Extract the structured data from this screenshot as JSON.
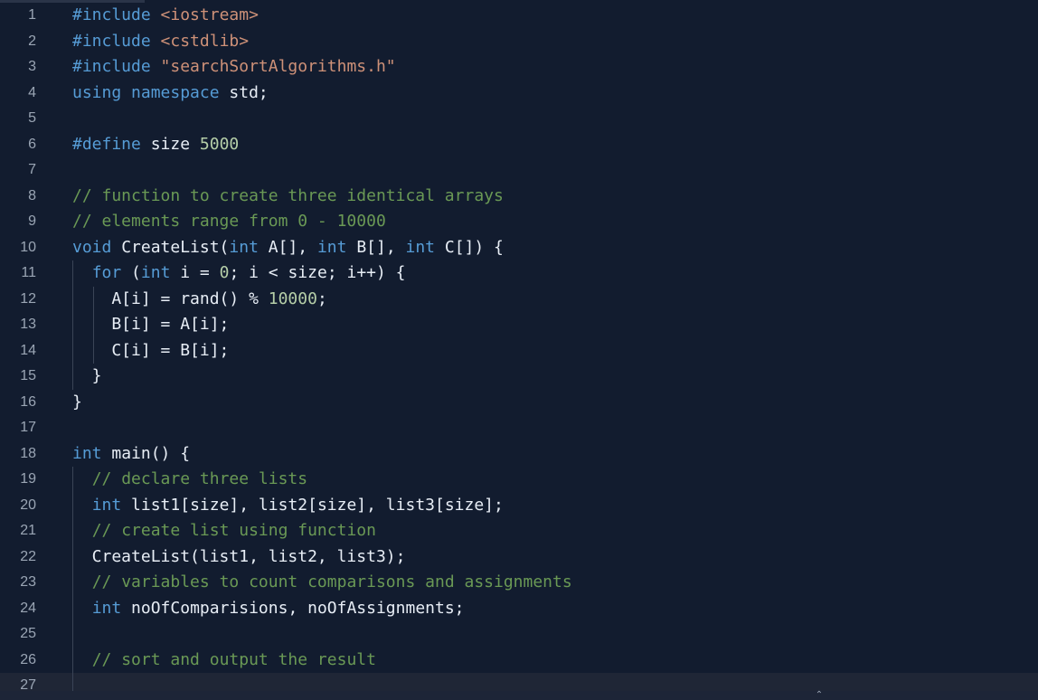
{
  "editor": {
    "lines": [
      {
        "n": "1",
        "tokens": [
          [
            "kw",
            "#include "
          ],
          [
            "str",
            "<iostream>"
          ]
        ]
      },
      {
        "n": "2",
        "tokens": [
          [
            "kw",
            "#include "
          ],
          [
            "str",
            "<cstdlib>"
          ]
        ]
      },
      {
        "n": "3",
        "tokens": [
          [
            "kw",
            "#include "
          ],
          [
            "str",
            "\"searchSortAlgorithms.h\""
          ]
        ]
      },
      {
        "n": "4",
        "tokens": [
          [
            "kw",
            "using "
          ],
          [
            "kw",
            "namespace "
          ],
          [
            "txt",
            "std;"
          ]
        ]
      },
      {
        "n": "5",
        "tokens": []
      },
      {
        "n": "6",
        "tokens": [
          [
            "kw",
            "#define "
          ],
          [
            "txt",
            "size "
          ],
          [
            "num",
            "5000"
          ]
        ]
      },
      {
        "n": "7",
        "tokens": []
      },
      {
        "n": "8",
        "tokens": [
          [
            "com",
            "// function to create three identical arrays"
          ]
        ]
      },
      {
        "n": "9",
        "tokens": [
          [
            "com",
            "// elements range from 0 - 10000"
          ]
        ]
      },
      {
        "n": "10",
        "tokens": [
          [
            "kw",
            "void "
          ],
          [
            "txt",
            "CreateList("
          ],
          [
            "kw",
            "int "
          ],
          [
            "txt",
            "A[], "
          ],
          [
            "kw",
            "int "
          ],
          [
            "txt",
            "B[], "
          ],
          [
            "kw",
            "int "
          ],
          [
            "txt",
            "C[]) {"
          ]
        ]
      },
      {
        "n": "11",
        "tokens": [
          [
            "txt",
            "  "
          ],
          [
            "kw",
            "for "
          ],
          [
            "txt",
            "("
          ],
          [
            "kw",
            "int "
          ],
          [
            "txt",
            "i = "
          ],
          [
            "num",
            "0"
          ],
          [
            "txt",
            "; i < size; i++) {"
          ]
        ]
      },
      {
        "n": "12",
        "tokens": [
          [
            "txt",
            "    A[i] = rand() % "
          ],
          [
            "num",
            "10000"
          ],
          [
            "txt",
            ";"
          ]
        ]
      },
      {
        "n": "13",
        "tokens": [
          [
            "txt",
            "    B[i] = A[i];"
          ]
        ]
      },
      {
        "n": "14",
        "tokens": [
          [
            "txt",
            "    C[i] = B[i];"
          ]
        ]
      },
      {
        "n": "15",
        "tokens": [
          [
            "txt",
            "  }"
          ]
        ]
      },
      {
        "n": "16",
        "tokens": [
          [
            "txt",
            "}"
          ]
        ]
      },
      {
        "n": "17",
        "tokens": []
      },
      {
        "n": "18",
        "tokens": [
          [
            "kw",
            "int "
          ],
          [
            "txt",
            "main() {"
          ]
        ]
      },
      {
        "n": "19",
        "tokens": [
          [
            "txt",
            "  "
          ],
          [
            "com",
            "// declare three lists"
          ]
        ]
      },
      {
        "n": "20",
        "tokens": [
          [
            "txt",
            "  "
          ],
          [
            "kw",
            "int "
          ],
          [
            "txt",
            "list1[size], list2[size], list3[size];"
          ]
        ]
      },
      {
        "n": "21",
        "tokens": [
          [
            "txt",
            "  "
          ],
          [
            "com",
            "// create list using function"
          ]
        ]
      },
      {
        "n": "22",
        "tokens": [
          [
            "txt",
            "  CreateList(list1, list2, list3);"
          ]
        ]
      },
      {
        "n": "23",
        "tokens": [
          [
            "txt",
            "  "
          ],
          [
            "com",
            "// variables to count comparisons and assignments"
          ]
        ]
      },
      {
        "n": "24",
        "tokens": [
          [
            "txt",
            "  "
          ],
          [
            "kw",
            "int "
          ],
          [
            "txt",
            "noOfComparisions, noOfAssignments;"
          ]
        ]
      },
      {
        "n": "25",
        "tokens": []
      },
      {
        "n": "26",
        "tokens": [
          [
            "txt",
            "  "
          ],
          [
            "com",
            "// sort and output the result"
          ]
        ]
      },
      {
        "n": "27",
        "tokens": [],
        "current": true
      }
    ]
  },
  "colors": {
    "background": "#121c2f",
    "keyword": "#569cd6",
    "string": "#ce9178",
    "number": "#b5cea8",
    "comment": "#6a9955",
    "text": "#e8eef6",
    "line_number": "#9aa5b4"
  },
  "scrollbar": {
    "up_icon": "chevron-up-icon"
  }
}
